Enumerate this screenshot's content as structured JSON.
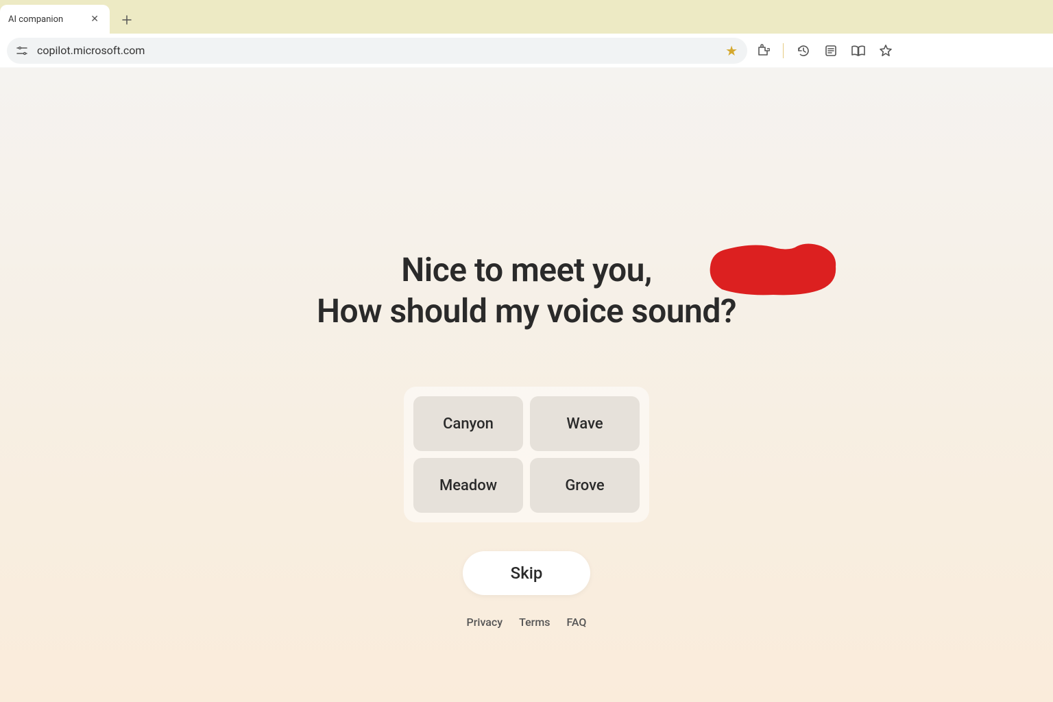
{
  "browser": {
    "tab_title": "AI companion",
    "url": "copilot.microsoft.com"
  },
  "heading": {
    "line1": "Nice to meet you,",
    "line2": "How should my voice sound?"
  },
  "voice_options": [
    "Canyon",
    "Wave",
    "Meadow",
    "Grove"
  ],
  "buttons": {
    "skip": "Skip"
  },
  "footer": {
    "privacy": "Privacy",
    "terms": "Terms",
    "faq": "FAQ"
  }
}
